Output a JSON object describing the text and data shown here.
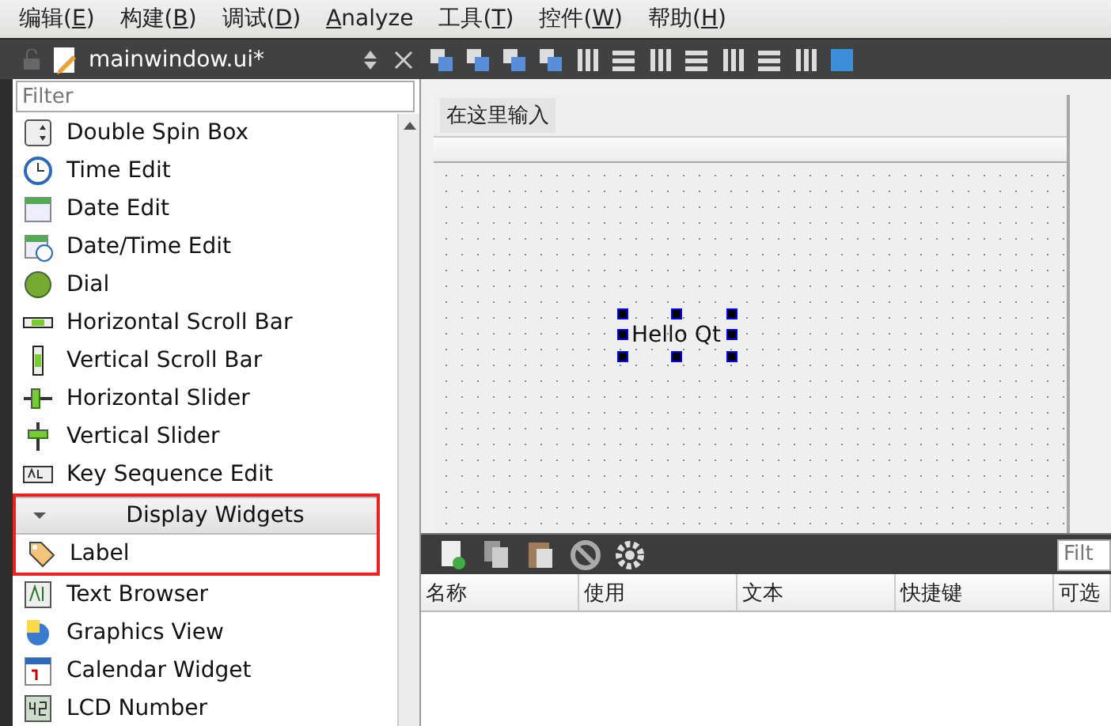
{
  "menu": [
    {
      "before": "编辑(",
      "key": "E",
      "after": ")"
    },
    {
      "before": "构建(",
      "key": "B",
      "after": ")"
    },
    {
      "before": "调试(",
      "key": "D",
      "after": ")"
    },
    {
      "key": "A",
      "after": "nalyze"
    },
    {
      "before": "工具(",
      "key": "T",
      "after": ")"
    },
    {
      "before": "控件(",
      "key": "W",
      "after": ")"
    },
    {
      "before": "帮助(",
      "key": "H",
      "after": ")"
    }
  ],
  "editor_bar": {
    "file_name": "mainwindow.ui*"
  },
  "widget_box": {
    "filter": {
      "placeholder": "Filter"
    },
    "items": [
      {
        "kind": "widget",
        "label": "Double Spin Box",
        "highlighted": false
      },
      {
        "kind": "widget",
        "label": "Time Edit",
        "highlighted": false
      },
      {
        "kind": "widget",
        "label": "Date Edit",
        "highlighted": false
      },
      {
        "kind": "widget",
        "label": "Date/Time Edit",
        "highlighted": false
      },
      {
        "kind": "widget",
        "label": "Dial",
        "highlighted": false
      },
      {
        "kind": "widget",
        "label": "Horizontal Scroll Bar",
        "highlighted": false
      },
      {
        "kind": "widget",
        "label": "Vertical Scroll Bar",
        "highlighted": false
      },
      {
        "kind": "widget",
        "label": "Horizontal Slider",
        "highlighted": false
      },
      {
        "kind": "widget",
        "label": "Vertical Slider",
        "highlighted": false
      },
      {
        "kind": "widget",
        "label": "Key Sequence Edit",
        "highlighted": false
      },
      {
        "kind": "category",
        "label": "Display Widgets",
        "expanded": true,
        "highlighted": true
      },
      {
        "kind": "widget",
        "label": "Label",
        "highlighted": true
      },
      {
        "kind": "widget",
        "label": "Text Browser",
        "highlighted": false
      },
      {
        "kind": "widget",
        "label": "Graphics View",
        "highlighted": false
      },
      {
        "kind": "widget",
        "label": "Calendar Widget",
        "highlighted": false
      },
      {
        "kind": "widget",
        "label": "LCD Number",
        "highlighted": false
      }
    ]
  },
  "form": {
    "menu_placeholder": "在这里输入",
    "label": {
      "text": "Hello Qt",
      "selected": true
    }
  },
  "action_editor": {
    "filter": {
      "placeholder": "Filt"
    },
    "columns": [
      "名称",
      "使用",
      "文本",
      "快捷键",
      "可选"
    ]
  }
}
